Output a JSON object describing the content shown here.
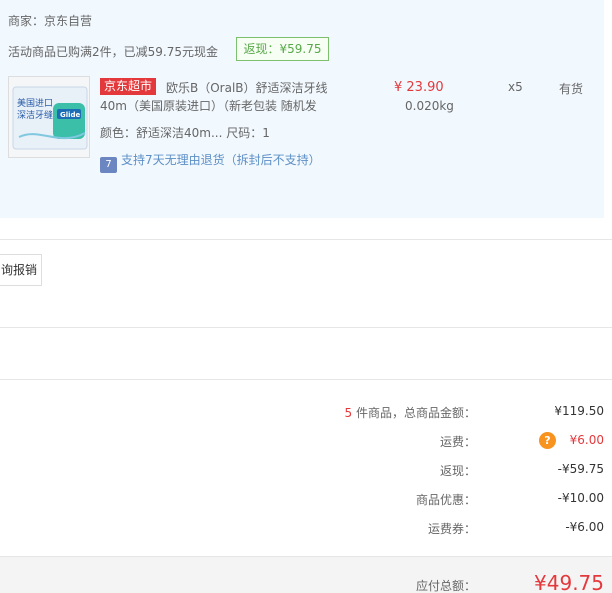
{
  "order": {
    "seller": "商家：京东自营",
    "promo": "活动商品已购满2件，已减59.75元现金",
    "rebate": "返现：¥59.75"
  },
  "product": {
    "store_tag": "京东超市",
    "title_line1": "欧乐B（OralB）舒适深洁牙线",
    "title_line2": "40m（美国原装进口）（新老包装 随机发",
    "variant": "颜色：舒适深洁40m... 尺码：1",
    "return_policy": "支持7天无理由退货（拆封后不支持）",
    "return_icon_text": "7",
    "unit_price": "¥ 23.90",
    "weight": "0.020kg",
    "quantity": "x5",
    "stock": "有货",
    "thumb_text_1": "美国进口",
    "thumb_text_2": "深洁牙缝",
    "thumb_brand": "Glide"
  },
  "actions": {
    "reimburse": "询报销"
  },
  "summary": {
    "items_count": "5",
    "items_label": " 件商品，总商品金额：",
    "items_amount": "¥119.50",
    "freight_label": "运费：",
    "freight_value": "¥6.00",
    "freight_help": "?",
    "rebate_label": "返现：",
    "rebate_value": "-¥59.75",
    "discount_label": "商品优惠：",
    "discount_value": "-¥10.00",
    "coupon_label": "运费券：",
    "coupon_value": "-¥6.00",
    "total_label": "应付总额：",
    "total_amount": "¥49.75"
  },
  "colors": {
    "accent_red": "#e4393c",
    "rebate_green": "#59a84a",
    "panel_blue": "#f1f8fe",
    "help_orange": "#f7931e"
  }
}
